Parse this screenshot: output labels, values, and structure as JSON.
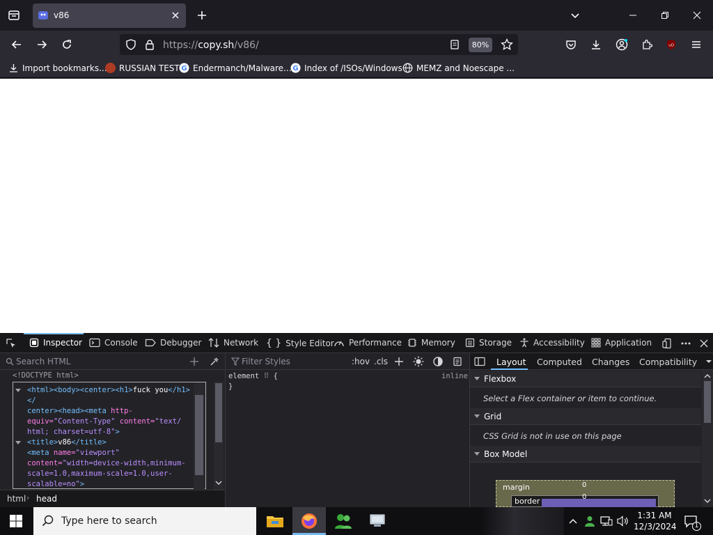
{
  "browser": {
    "tab_title": "v86",
    "url_prefix": "https://",
    "url_host": "copy.sh",
    "url_path": "/v86/",
    "zoom": "80%"
  },
  "bookmarks": [
    {
      "label": "Import bookmarks...",
      "icon": "import-icon"
    },
    {
      "label": "RUSSIAN TEST",
      "icon": "favicon-icon"
    },
    {
      "label": "Endermanch/Malware...",
      "icon": "google-icon"
    },
    {
      "label": "Index of /ISOs/Windows",
      "icon": "google-icon"
    },
    {
      "label": "MEMZ and Noescape ...",
      "icon": "globe-icon"
    }
  ],
  "devtools": {
    "tabs": [
      "Inspector",
      "Console",
      "Debugger",
      "Network",
      "Style Editor",
      "Performance",
      "Memory",
      "Storage",
      "Accessibility",
      "Application"
    ],
    "search_placeholder": "Search HTML",
    "filter_placeholder": "Filter Styles",
    "hov": ":hov",
    "cls": ".cls",
    "doctype": "<!DOCTYPE html>",
    "markup": {
      "line1_tags_a": "<html><body><center><h1>",
      "line1_text": "fuck you",
      "line1_tags_b": "</h1></",
      "line2_a": "center><",
      "line2_b": "head><meta",
      "line2_attr": " http-",
      "line3_attr": "equiv=",
      "line3_val": "\"Content-Type\"",
      "line3_attr2": " content=",
      "line3_val2": "\"text/",
      "line4_val": "html; charset=utf-8\"",
      "line4_close": ">",
      "line5": "<title>",
      "line5_text": "v86",
      "line5_close": "</title>",
      "line6_tag": "<meta",
      "line6_attr": " name=",
      "line6_val": "\"viewport\"",
      "line7_attr": "content=",
      "line7_val": "\"width=device-width,minimum-",
      "line8_val": "scale=1.0,maximum-scale=1.0,user-",
      "line9_val": "scalable=no\"",
      "line9_close": ">"
    },
    "breadcrumbs": [
      "html",
      "head"
    ],
    "rules": {
      "selector": "element",
      "brace_open": "{",
      "brace_close": "}",
      "source": "inline"
    },
    "layout_tabs": [
      "Layout",
      "Computed",
      "Changes",
      "Compatibility"
    ],
    "sections": [
      {
        "title": "Flexbox",
        "body": "Select a Flex container or item to continue."
      },
      {
        "title": "Grid",
        "body": "CSS Grid is not in use on this page"
      },
      {
        "title": "Box Model",
        "body": ""
      }
    ],
    "box_model": {
      "margin_label": "margin",
      "margin_value": "0",
      "border_label": "border",
      "border_value": "0"
    }
  },
  "taskbar": {
    "search_placeholder": "Type here to search",
    "time": "1:31 AM",
    "date": "12/3/2024",
    "notification_count": "1"
  }
}
